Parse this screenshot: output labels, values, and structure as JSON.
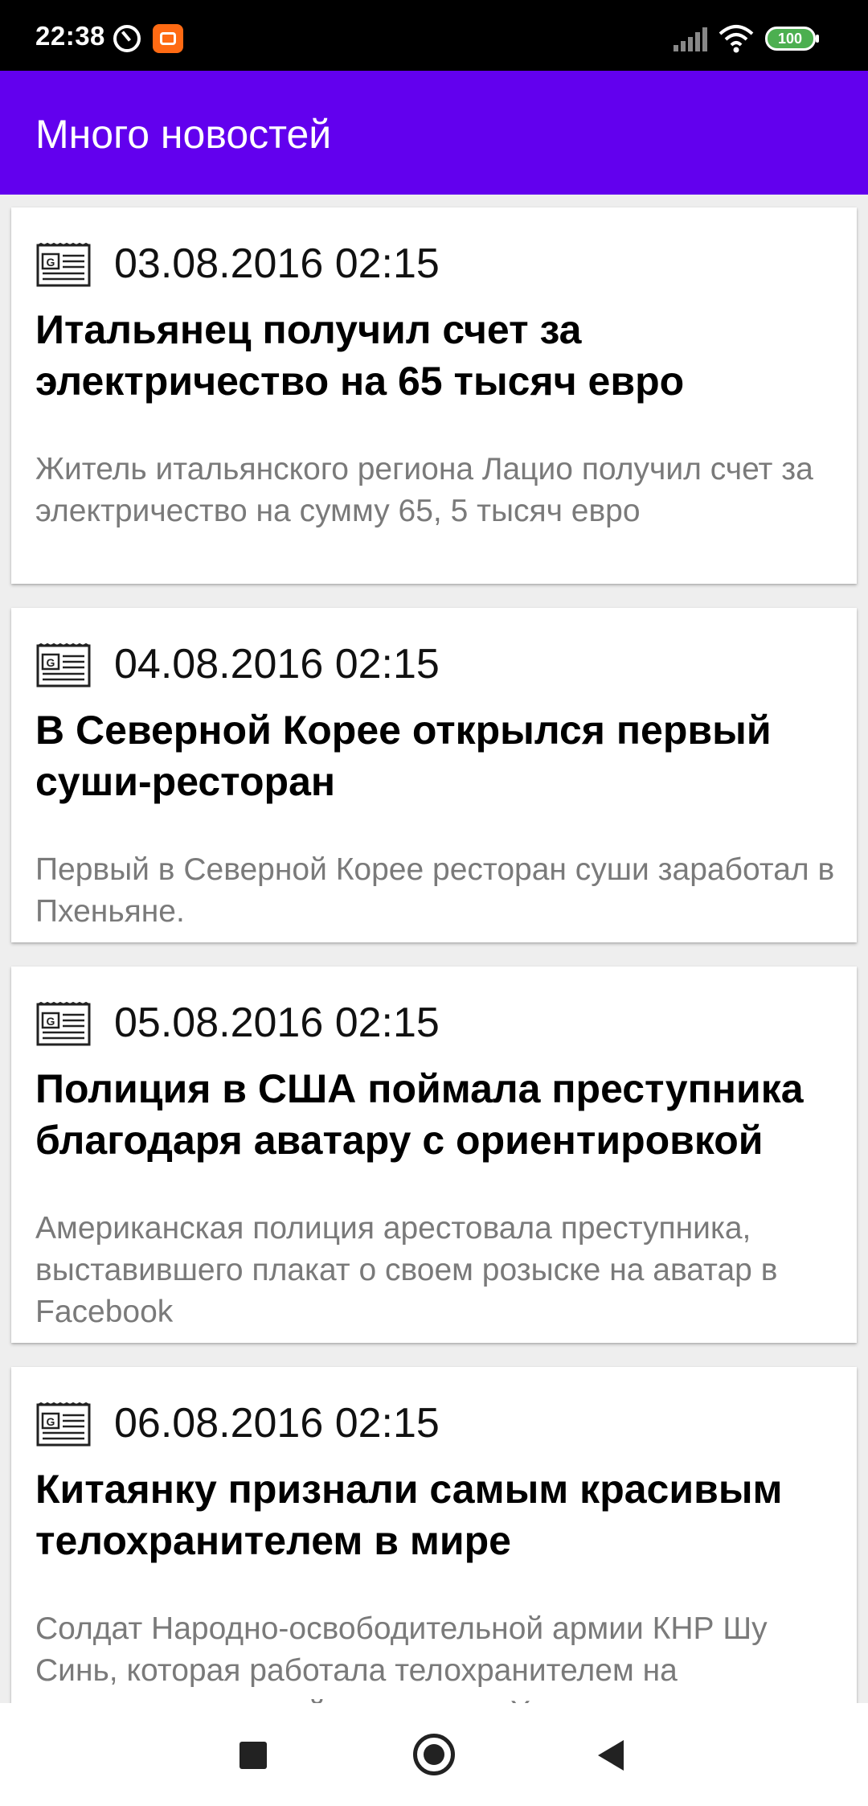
{
  "status_bar": {
    "time": "22:38",
    "battery": "100",
    "icons": [
      "do-not-disturb-icon",
      "mi-app-icon",
      "signal-icon",
      "wifi-icon",
      "battery-icon"
    ]
  },
  "app_bar": {
    "title": "Много новостей",
    "color": "#6200ee"
  },
  "news": [
    {
      "icon": "newspaper-icon",
      "date": "03.08.2016 02:15",
      "title": "Итальянец получил счет за электричество на 65 тысяч евро",
      "description": "Житель итальянского региона Лацио получил счет за электричество на сумму 65, 5 тысяч евро"
    },
    {
      "icon": "newspaper-icon",
      "date": "04.08.2016 02:15",
      "title": "В Северной Корее открылся первый суши-ресторан",
      "description": "Первый в Северной Корее ресторан суши заработал в Пхеньяне."
    },
    {
      "icon": "newspaper-icon",
      "date": "05.08.2016 02:15",
      "title": "Полиция в США поймала преступника благодаря аватару с ориентировкой",
      "description": "Американская полиция арестовала преступника, выставившего плакат о своем розыске на аватар в Facebook"
    },
    {
      "icon": "newspaper-icon",
      "date": "06.08.2016 02:15",
      "title": "Китаянку признали самым красивым телохранителем в мире",
      "description": "Солдат Народно-освободительной армии КНР Шу Синь, которая работала телохранителем на прошедшем в китайском городе Ханчжоу"
    }
  ],
  "nav_bar": {
    "icons": [
      "recents-square-icon",
      "home-circle-icon",
      "back-triangle-icon"
    ]
  }
}
